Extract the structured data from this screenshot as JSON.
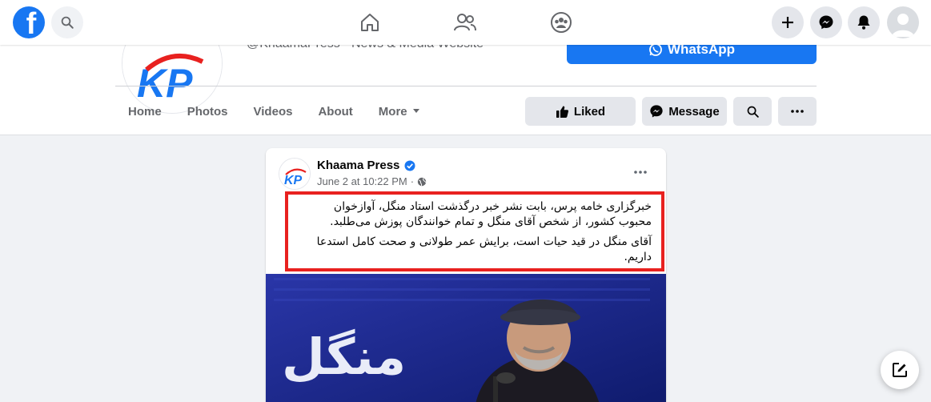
{
  "topnav": {
    "logo_letter": "f",
    "icons": [
      "facebook-logo",
      "search-icon",
      "home-icon",
      "friends-icon",
      "groups-icon",
      "plus-icon",
      "messenger-icon",
      "notifications-icon",
      "profile-avatar"
    ]
  },
  "page": {
    "handle": "@KhaamaPress · News & Media Website",
    "whatsapp_label": "WhatsApp",
    "tabs": [
      {
        "label": "Home"
      },
      {
        "label": "Photos"
      },
      {
        "label": "Videos"
      },
      {
        "label": "About"
      },
      {
        "label": "More"
      }
    ],
    "liked_label": "Liked",
    "message_label": "Message"
  },
  "post": {
    "author": "Khaama Press",
    "date": "June 2 at 10:22 PM",
    "separator": "·",
    "avatar_initials": "KP",
    "paragraph1": "خبرگزاری خامه پرس، بابت نشر خبر درگذشت استاد منگل، آوازخوان محبوب کشور، از شخص آقای منگل و تمام خوانندگان پوزش می‌طلبد.",
    "paragraph2": "آقای منگل در قید حیات است، برایش عمر طولانی و صحت کامل استدعا داریم.",
    "image_caption": "منگل"
  },
  "colors": {
    "brand": "#1877f2",
    "highlight_border": "#e8211f",
    "background": "#f0f2f5"
  }
}
